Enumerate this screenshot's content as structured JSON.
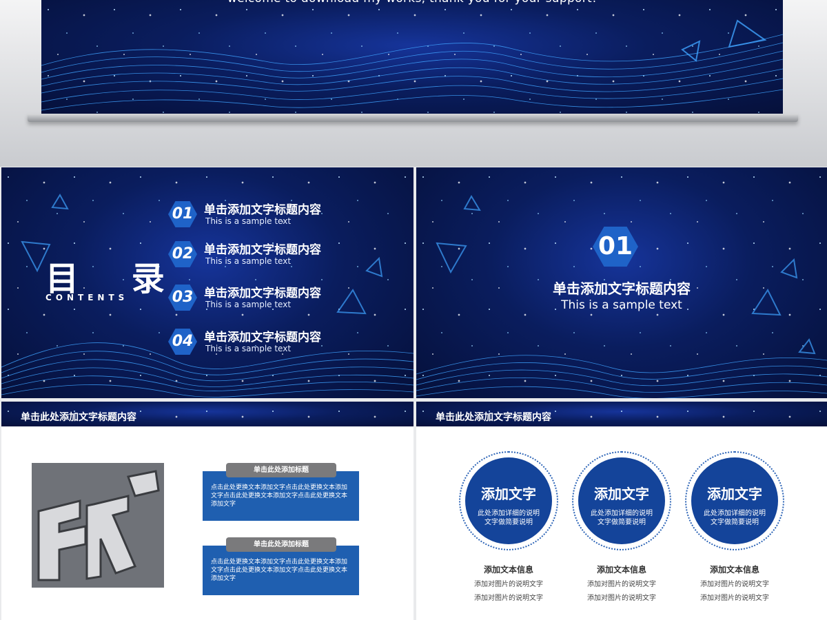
{
  "hero": {
    "text": "welcome to download my works, thank you for your support!"
  },
  "toc": {
    "title": "目  录",
    "subtitle": "CONTENTS",
    "items": [
      {
        "num": "01",
        "title": "单击添加文字标题内容",
        "sample": "This is a sample text"
      },
      {
        "num": "02",
        "title": "单击添加文字标题内容",
        "sample": "This is a sample text"
      },
      {
        "num": "03",
        "title": "单击添加文字标题内容",
        "sample": "This is a sample text"
      },
      {
        "num": "04",
        "title": "单击添加文字标题内容",
        "sample": "This is a sample text"
      }
    ]
  },
  "section": {
    "num": "01",
    "title": "单击添加文字标题内容",
    "sample": "This is a sample text"
  },
  "text_slide": {
    "bar_title": "单击此处添加文字标题内容",
    "cards": [
      {
        "tab": "单击此处添加标题",
        "body": "点击此处更换文本添加文字点击此处更换文本添加文字点击此处更换文本添加文字点击此处更换文本添加文字"
      },
      {
        "tab": "单击此处添加标题",
        "body": "点击此处更换文本添加文字点击此处更换文本添加文字点击此处更换文本添加文字点击此处更换文本添加文字"
      }
    ]
  },
  "circle_slide": {
    "bar_title": "单击此处添加文字标题内容",
    "circles": [
      {
        "title": "添加文字",
        "line1": "此处添加详细的说明",
        "line2": "文字做简要说明",
        "info_title": "添加文本信息",
        "info1": "添加对图片的说明文字",
        "info2": "添加对图片的说明文字"
      },
      {
        "title": "添加文字",
        "line1": "此处添加详细的说明",
        "line2": "文字做简要说明",
        "info_title": "添加文本信息",
        "info1": "添加对图片的说明文字",
        "info2": "添加对图片的说明文字"
      },
      {
        "title": "添加文字",
        "line1": "此处添加详细的说明",
        "line2": "文字做简要说明",
        "info_title": "添加文本信息",
        "info1": "添加对图片的说明文字",
        "info2": "添加对图片的说明文字"
      }
    ]
  },
  "colors": {
    "accent": "#1f63c8",
    "deep_blue": "#0a1d5e",
    "circle_blue": "#14449a",
    "card_blue": "#1f5fb0"
  }
}
